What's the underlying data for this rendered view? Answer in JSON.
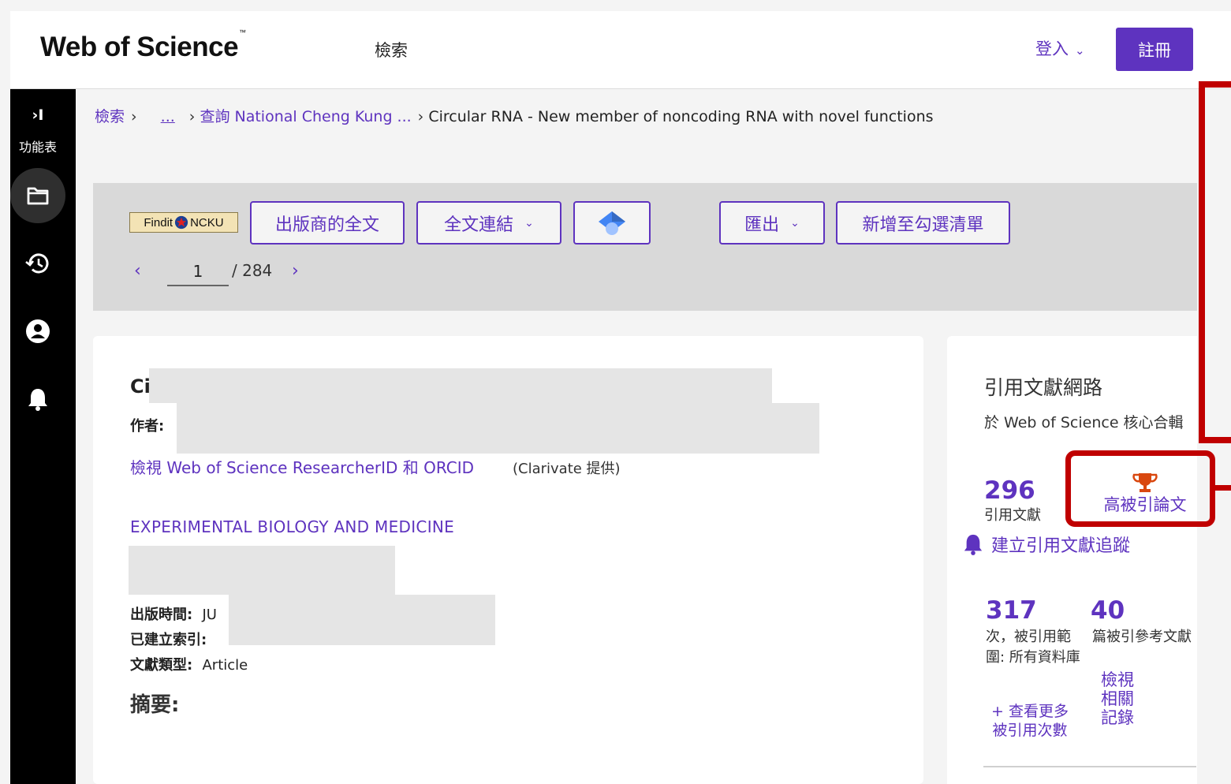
{
  "header": {
    "logo": "Web of Science",
    "logo_tm": "™",
    "nav_search": "檢索",
    "login_label": "登入",
    "register_label": "註冊"
  },
  "sidebar": {
    "expand_symbol": "›I",
    "menu_label": "功能表",
    "items": [
      {
        "icon": "folder-icon"
      },
      {
        "icon": "history-icon"
      },
      {
        "icon": "account-icon"
      },
      {
        "icon": "bell-icon"
      }
    ]
  },
  "breadcrumb": {
    "items": [
      "檢索",
      "...",
      "查詢 National Cheng Kung ..."
    ],
    "current": "Circular RNA - New member of noncoding RNA with novel functions",
    "separator": "›"
  },
  "toolbar": {
    "findit_left": "Findit",
    "findit_right": "NCKU",
    "publisher_fulltext": "出版商的全文",
    "fulltext_links": "全文連結",
    "export": "匯出",
    "add_to_marked_list": "新增至勾選清單",
    "pager": {
      "current": "1",
      "total": "/ 284"
    }
  },
  "article": {
    "title_visible": "Ci",
    "authors_label": "作者:",
    "researcher_link": "檢視 Web of Science ResearcherID 和 ORCID",
    "provided_by": "(Clarivate 提供)",
    "journal": "EXPERIMENTAL BIOLOGY AND MEDICINE",
    "published_label": "出版時間:",
    "published_value": "JU",
    "indexed_label": "已建立索引:",
    "doc_type_label": "文獻類型:",
    "doc_type_value": "Article",
    "abstract_label": "摘要:"
  },
  "citation_network": {
    "title": "引用文獻網路",
    "subtitle": "於 Web of Science 核心合輯",
    "citations_count": "296",
    "citations_label": "引用文獻",
    "highly_cited_label": "高被引論文",
    "create_alert": "建立引用文獻追蹤",
    "times_cited_all": "317",
    "times_cited_all_label": "次，被引用範圍: 所有資料庫",
    "cited_references": "40",
    "cited_references_label": "篇被引參考文獻",
    "view_related": "檢視相關記錄",
    "see_more_times_cited": "+ 查看更多被引用次數"
  },
  "colors": {
    "accent": "#5e33bf",
    "sidebar_bg": "#000000",
    "annotation_red": "#c00000",
    "trophy": "#d9480f"
  }
}
